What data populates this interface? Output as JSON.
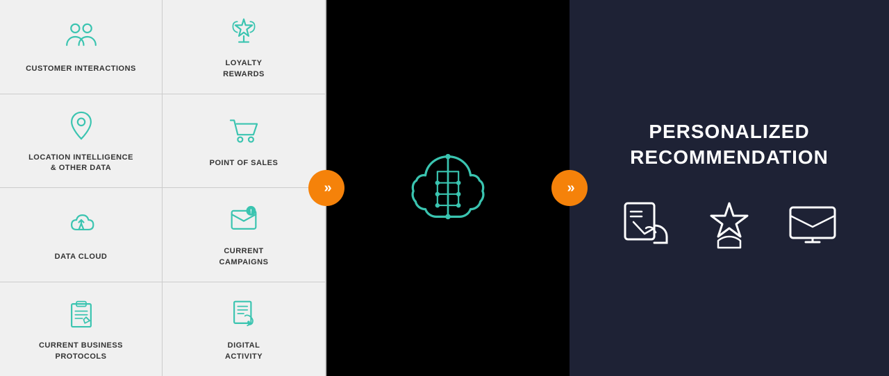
{
  "leftPanel": {
    "cells": [
      {
        "id": "customer-interactions",
        "label": "CUSTOMER\nINTERACTIONS",
        "icon": "people"
      },
      {
        "id": "loyalty-rewards",
        "label": "LOYALTY\nREWARDS",
        "icon": "trophy"
      },
      {
        "id": "location-intelligence",
        "label": "LOCATION INTELLIGENCE\n& OTHER DATA",
        "icon": "location"
      },
      {
        "id": "point-of-sales",
        "label": "POINT OF SALES",
        "icon": "cart"
      },
      {
        "id": "data-cloud",
        "label": "DATA CLOUD",
        "icon": "cloud"
      },
      {
        "id": "current-campaigns",
        "label": "CURRENT\nCAMPAIGNS",
        "icon": "email-badge"
      },
      {
        "id": "current-business-protocols",
        "label": "CURRENT BUSINESS\nPROTOCOLS",
        "icon": "clipboard"
      },
      {
        "id": "digital-activity",
        "label": "DIGITAL\nACTIVITY",
        "icon": "digital"
      }
    ]
  },
  "middle": {
    "arrowLeft": "»",
    "arrowRight": "»"
  },
  "rightPanel": {
    "title": "PERSONALIZED\nRECOMMENDATION",
    "icons": [
      "swipe",
      "star-hand",
      "email-monitor"
    ]
  }
}
